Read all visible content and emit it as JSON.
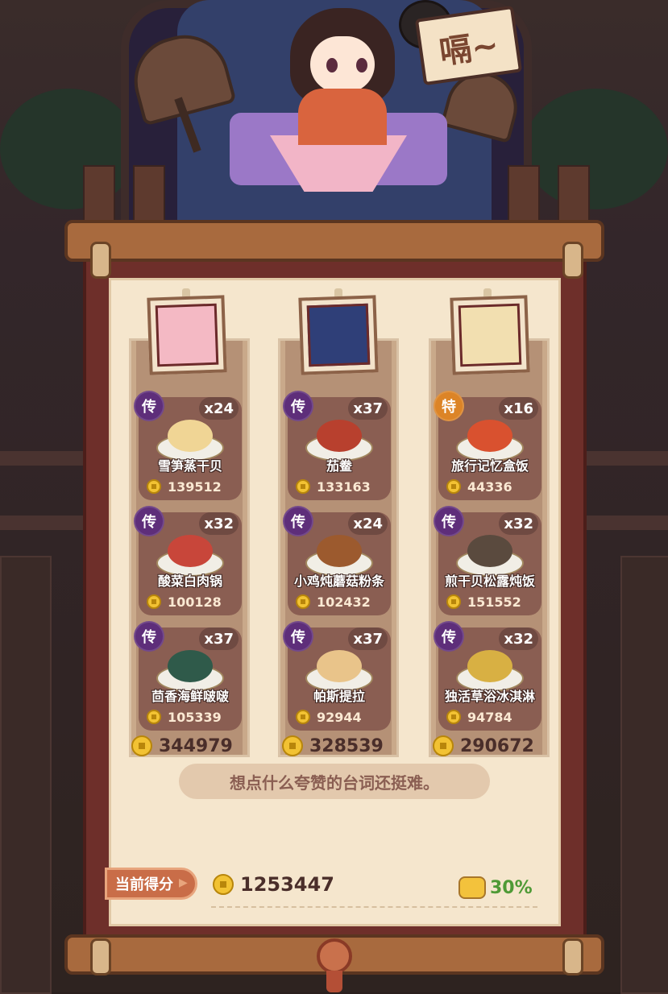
{
  "header": {
    "sign_text": "嗝~"
  },
  "columns": [
    {
      "total": "344979",
      "dishes": [
        {
          "rarity": "传",
          "qty": "x24",
          "name": "雪笋蒸干贝",
          "score": "139512",
          "food_color": "#f0d595"
        },
        {
          "rarity": "传",
          "qty": "x32",
          "name": "酸菜白肉锅",
          "score": "100128",
          "food_color": "#c8463a"
        },
        {
          "rarity": "传",
          "qty": "x37",
          "name": "茴香海鲜啵啵",
          "score": "105339",
          "food_color": "#2f5a4a"
        }
      ]
    },
    {
      "total": "328539",
      "dishes": [
        {
          "rarity": "传",
          "qty": "x37",
          "name": "茄鲞",
          "score": "133163",
          "food_color": "#b8402e"
        },
        {
          "rarity": "传",
          "qty": "x24",
          "name": "小鸡炖蘑菇粉条",
          "score": "102432",
          "food_color": "#9c5a2e"
        },
        {
          "rarity": "传",
          "qty": "x37",
          "name": "帕斯提拉",
          "score": "92944",
          "food_color": "#e9c48a"
        }
      ]
    },
    {
      "total": "290672",
      "dishes": [
        {
          "rarity": "特",
          "qty": "x16",
          "name": "旅行记忆盒饭",
          "score": "44336",
          "food_color": "#d9512f"
        },
        {
          "rarity": "传",
          "qty": "x32",
          "name": "煎干贝松露炖饭",
          "score": "151552",
          "food_color": "#5a4a3e"
        },
        {
          "rarity": "传",
          "qty": "x32",
          "name": "独活草浴冰淇淋",
          "score": "94784",
          "food_color": "#d8b043"
        }
      ]
    }
  ],
  "quote": "想点什么夸赞的台词还挺难。",
  "footer": {
    "score_label": "当前得分",
    "total_score": "1253447",
    "bonus_percent": "30%"
  },
  "colors": {
    "legend_badge": "#5e2e7a",
    "special_badge": "#dc8427",
    "bonus_text": "#4f9a36"
  }
}
